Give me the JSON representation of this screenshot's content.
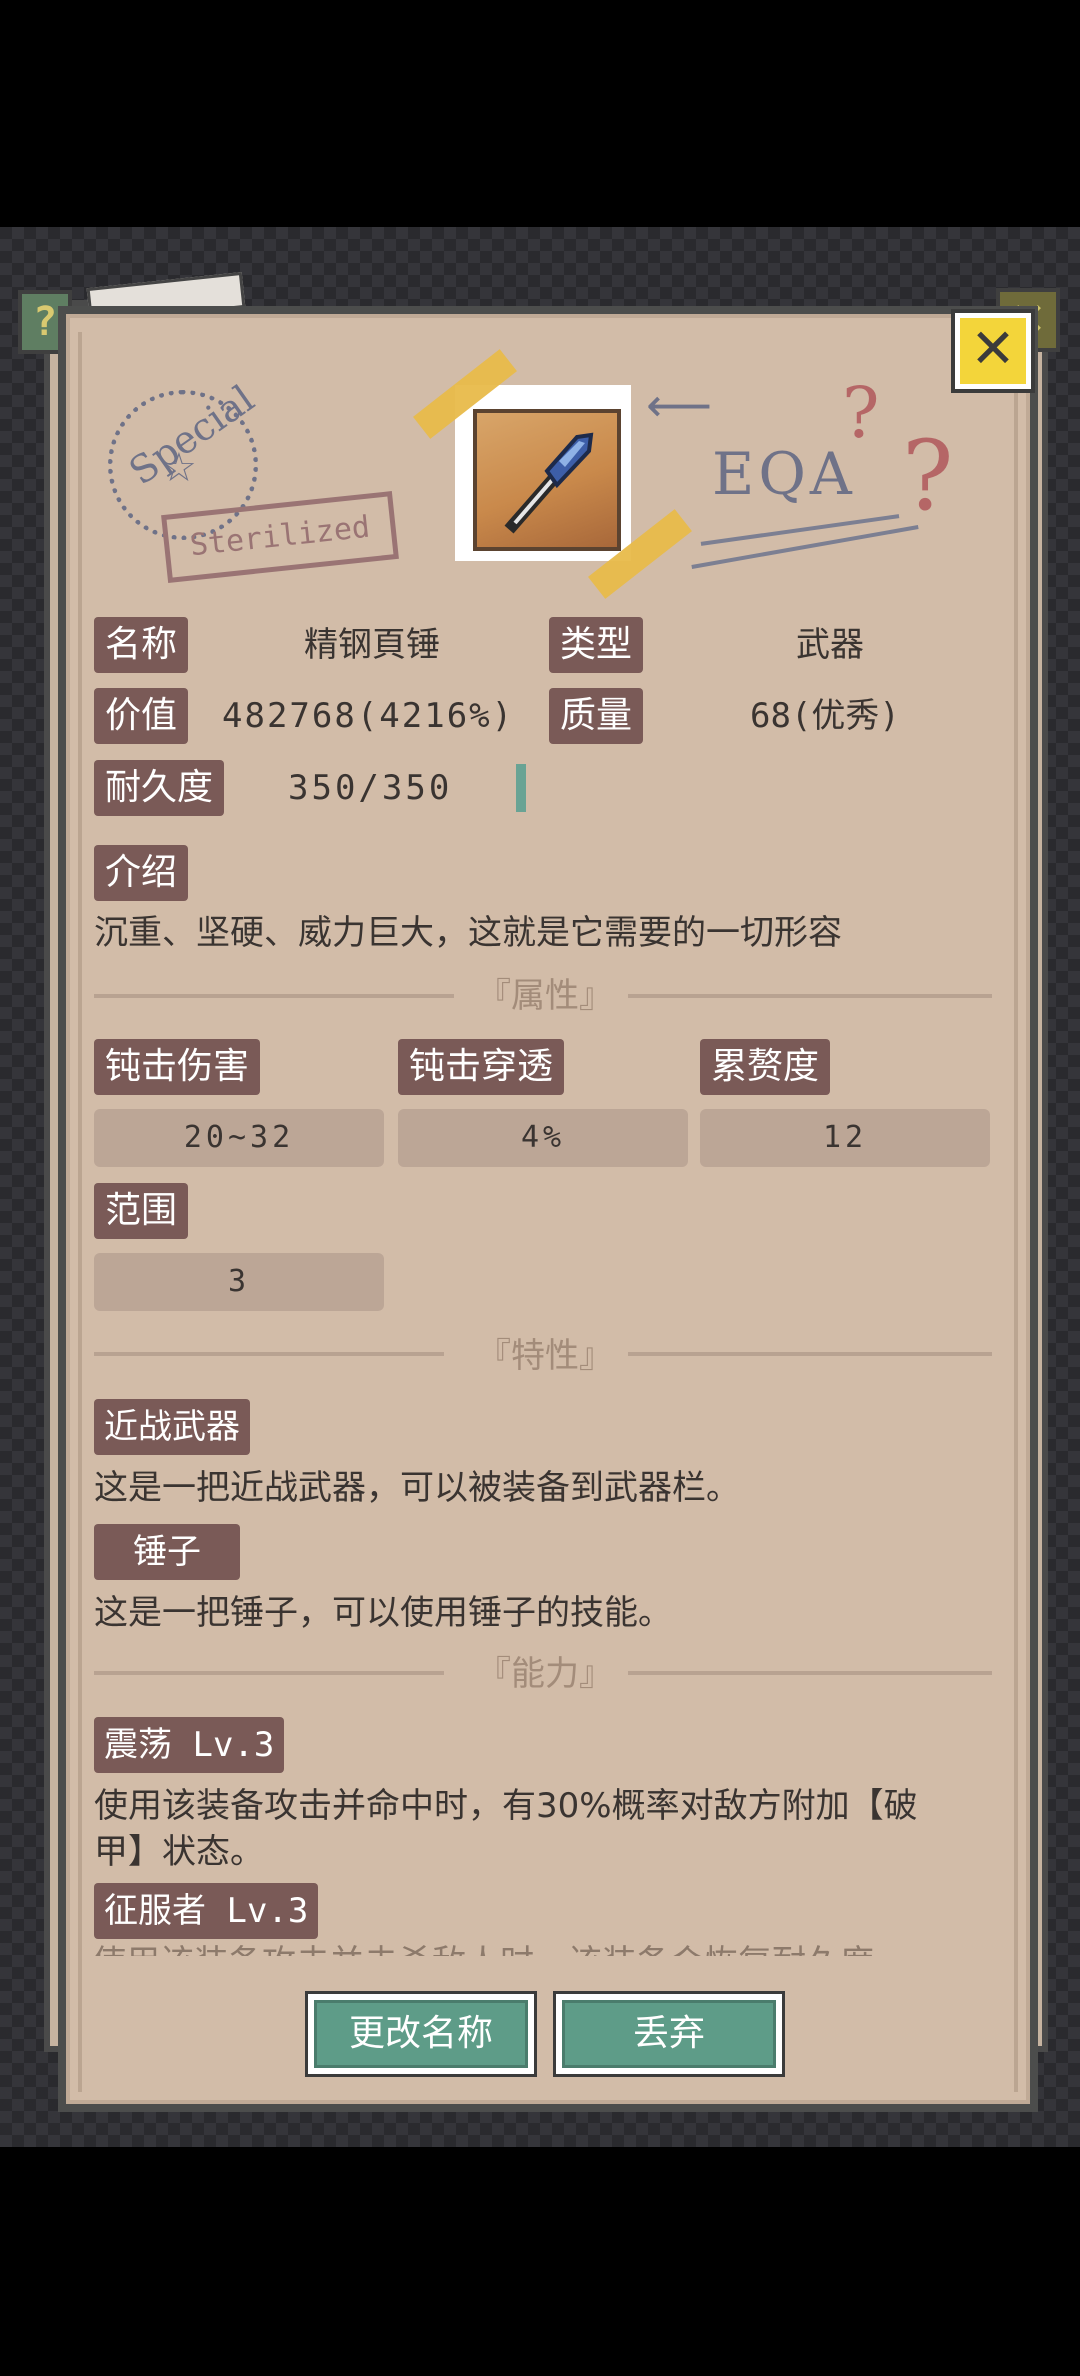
{
  "panel": {
    "close_icon": "close-x-icon"
  },
  "stamps": {
    "special": "Special",
    "sterilized": "Sterilized",
    "eqa": "EQA",
    "question": "?"
  },
  "item": {
    "icon": "blue-steel-hammer-icon"
  },
  "info": {
    "name_label": "名称",
    "name_value": "精钢頁锤",
    "type_label": "类型",
    "type_value": "武器",
    "value_label": "价值",
    "value_value": "482768(4216%)",
    "quality_label": "质量",
    "quality_value": "68(优秀)",
    "durability_label": "耐久度",
    "durability_value": "350/350",
    "durability_fraction": 1.0
  },
  "intro": {
    "label": "介绍",
    "text": "沉重、坚硬、威力巨大，这就是它需要的一切形容"
  },
  "attributes": {
    "section_title": "『属性』",
    "items": [
      {
        "label": "钝击伤害",
        "value": "20~32"
      },
      {
        "label": "钝击穿透",
        "value": "4%"
      },
      {
        "label": "累赘度",
        "value": "12"
      },
      {
        "label": "范围",
        "value": "3"
      }
    ]
  },
  "traits": {
    "section_title": "『特性』",
    "items": [
      {
        "label": "近战武器",
        "text": "这是一把近战武器，可以被装备到武器栏。"
      },
      {
        "label": "锤子",
        "text": "这是一把锤子，可以使用锤子的技能。"
      }
    ]
  },
  "abilities": {
    "section_title": "『能力』",
    "items": [
      {
        "label": "震荡 Lv.3",
        "text_line1": "使用该装备攻击并命中时，有30%概率对敌方附加【破",
        "text_line2": "甲】状态。"
      },
      {
        "label": "征服者 Lv.3",
        "text_line1": "使用该装备攻击并击杀敌人时，该装备会恢复耐久度。"
      }
    ]
  },
  "buttons": {
    "rename": "更改名称",
    "discard": "丢弃"
  },
  "colors": {
    "panel_bg": "#d2bca8",
    "label_bg": "#7a5a57",
    "button_bg": "#5e9c88",
    "close_bg": "#f3d53a"
  }
}
